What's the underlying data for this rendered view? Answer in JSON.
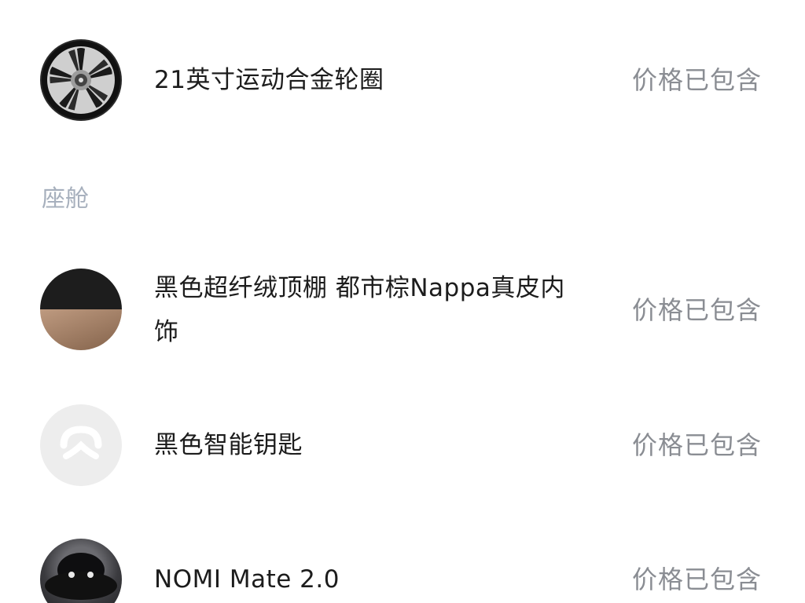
{
  "items_top": [
    {
      "name": "21英寸运动合金轮圈",
      "price": "价格已包含",
      "icon": "wheel-icon"
    }
  ],
  "section": {
    "title": "座舱"
  },
  "items_cabin": [
    {
      "name": "黑色超纤绒顶棚 都市棕Nappa真皮内饰",
      "price": "价格已包含",
      "icon": "interior-swatch-icon"
    },
    {
      "name": "黑色智能钥匙",
      "price": "价格已包含",
      "icon": "nio-logo-icon"
    },
    {
      "name": "NOMI Mate 2.0",
      "price": "价格已包含",
      "icon": "nomi-device-icon"
    }
  ],
  "colors": {
    "price_text": "#8a8d93",
    "section_title": "#a7b0bd",
    "item_text": "#1c1c1c"
  }
}
